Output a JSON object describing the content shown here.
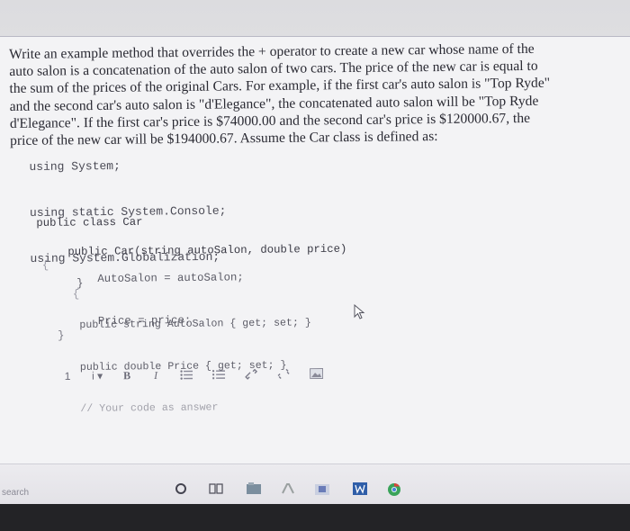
{
  "question": {
    "lines": [
      "Write an example method that overrides the + operator to create a new car whose name of the",
      "auto salon is a concatenation of the auto salon of two cars. The price of the new car is equal to",
      "the sum of the prices of the original Cars. For example, if the first car's auto salon is \"Top Ryde\"",
      "and the second car's auto salon is \"d'Elegance\", the concatenated auto salon will be \"Top Ryde",
      "d'Elegance\". If the first car's price is $74000.00 and the second car's price is $120000.67, the",
      "price of the new car will be $194000.67. Assume the Car class is defined as:"
    ]
  },
  "code": {
    "using": [
      "using System;",
      "using static System.Console;",
      "using System.Globalization;"
    ],
    "class_decl": "public class Car",
    "open_brace": "{",
    "ctor_decl": "public Car(string autoSalon, double price)",
    "ctor_open": "{",
    "ctor_body": [
      "AutoSalon = autoSalon;",
      "Price = price;"
    ],
    "ctor_close": "}",
    "props": [
      "public string AutoSalon { get; set; }",
      "public double Price { get; set; }"
    ],
    "comment": "// Your code as answer",
    "class_close": "}"
  },
  "toolbar": {
    "items": [
      "1",
      "i",
      "B",
      "I"
    ]
  },
  "taskbar": {
    "search_label": "search"
  },
  "colors": {
    "text": "#2a2a33",
    "code": "#3a3a45",
    "comment": "#a2a2ab",
    "taskbar": "#e6e5ea"
  }
}
